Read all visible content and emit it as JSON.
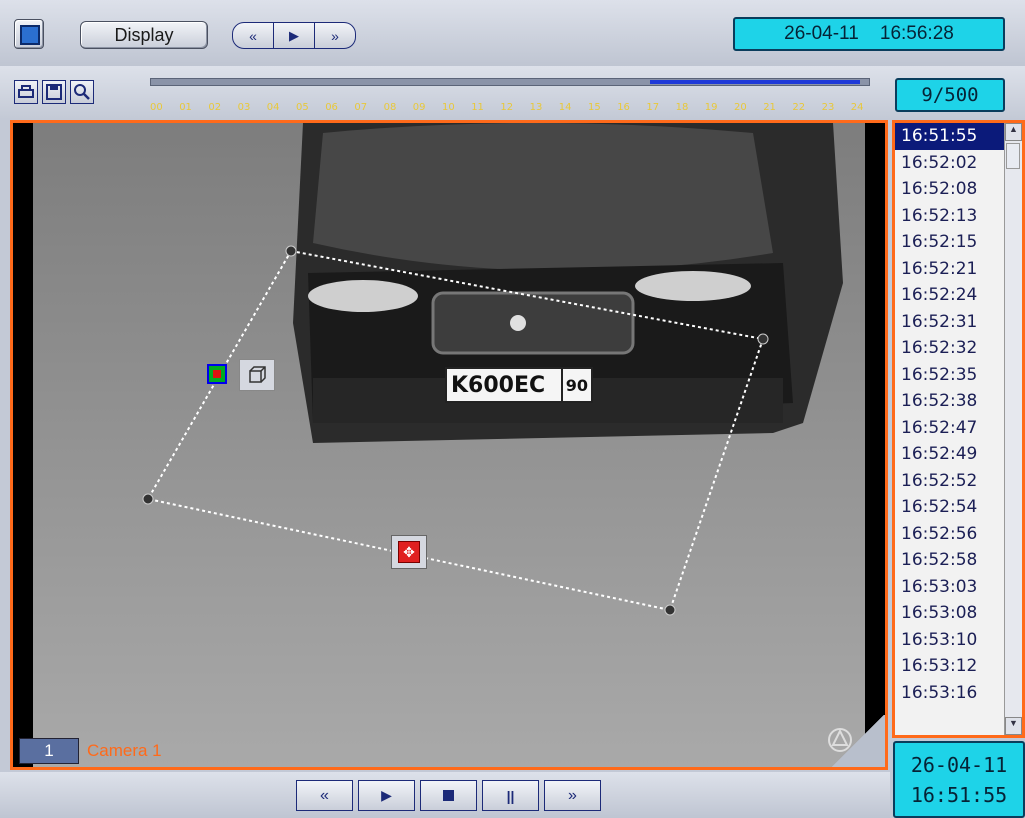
{
  "toolbar": {
    "display_label": "Display",
    "datetime": "26-04-11    16:56:28",
    "counter": "9/500"
  },
  "timeline": {
    "hours": [
      "00",
      "01",
      "02",
      "03",
      "04",
      "05",
      "06",
      "07",
      "08",
      "09",
      "10",
      "11",
      "12",
      "13",
      "14",
      "15",
      "16",
      "17",
      "18",
      "19",
      "20",
      "21",
      "22",
      "23",
      "24"
    ],
    "highlight_from_hour": 17,
    "highlight_to_hour": 24
  },
  "video": {
    "camera_number": "1",
    "camera_name": "Camera 1",
    "plate_main": "K600EC",
    "plate_region": "90"
  },
  "times": {
    "items": [
      "16:51:55",
      "16:52:02",
      "16:52:08",
      "16:52:13",
      "16:52:15",
      "16:52:21",
      "16:52:24",
      "16:52:31",
      "16:52:32",
      "16:52:35",
      "16:52:38",
      "16:52:47",
      "16:52:49",
      "16:52:52",
      "16:52:54",
      "16:52:56",
      "16:52:58",
      "16:53:03",
      "16:53:08",
      "16:53:10",
      "16:53:12",
      "16:53:16"
    ],
    "selected_index": 0
  },
  "footer": {
    "date": "26-04-11",
    "time": "16:51:55"
  },
  "colors": {
    "accent_orange": "#ff6a1a",
    "cyan_display": "#1ed3e8",
    "selection_navy": "#0b1a7a",
    "timeline_hour_label": "#e8c83a"
  }
}
